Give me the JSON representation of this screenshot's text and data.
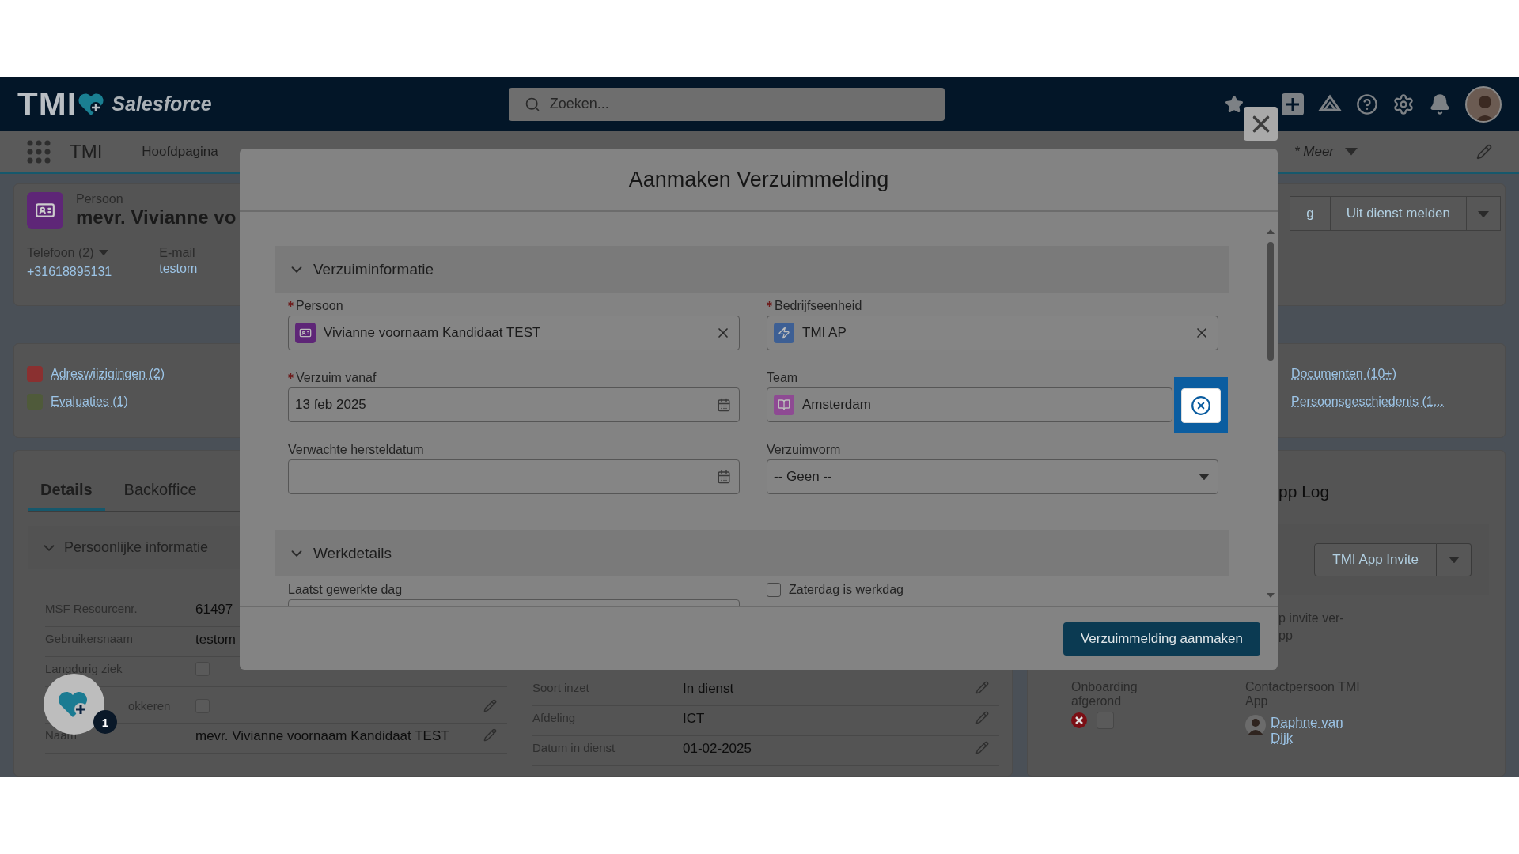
{
  "header": {
    "logo": "TMI",
    "brand": "Salesforce",
    "search": {
      "placeholder": "Zoeken..."
    }
  },
  "nav": {
    "app": "TMI",
    "items": [
      {
        "label": "Hoofdpagina"
      }
    ],
    "more": "* Meer"
  },
  "record": {
    "type": "Persoon",
    "name": "mevr. Vivianne vo",
    "phone_label": "Telefoon (2)",
    "phone": "+31618895131",
    "email_label": "E-mail",
    "email": "testom",
    "actions": [
      "g",
      "Uit dienst melden"
    ]
  },
  "related": {
    "left": [
      {
        "label": "Adreswijzigingen (2)",
        "color": "#8a3030"
      },
      {
        "label": "Evaluaties (1)",
        "color": "#4f5a3a"
      }
    ],
    "right": [
      {
        "label": "Documenten (10+)"
      },
      {
        "label": "Persoonsgeschiedenis (1..."
      }
    ]
  },
  "details": {
    "tabs": [
      {
        "label": "Details",
        "selected": true
      },
      {
        "label": "Backoffice",
        "selected": false
      }
    ],
    "section": "Persoonlijke informatie",
    "rows": [
      {
        "kind": "text",
        "label": "MSF Resourcenr.",
        "value": "61497",
        "covered": false
      },
      {
        "kind": "text",
        "label": "Gebruikersnaam",
        "value": "testom",
        "covered": false
      },
      {
        "kind": "checkbox",
        "label": "Langdurig ziek",
        "checked": false,
        "covered": false
      },
      {
        "kind": "checkbox",
        "label": "okkeren",
        "checked": false,
        "covered": true
      },
      {
        "kind": "text",
        "label": "Naam",
        "value": "mevr. Vivianne voornaam Kandidaat TEST",
        "covered": false
      }
    ],
    "rows_right": [
      {
        "label": "Soort inzet",
        "value": "In dienst"
      },
      {
        "label": "Afdeling",
        "value": "ICT"
      },
      {
        "label": "Datum in dienst",
        "value": "01-02-2025"
      }
    ]
  },
  "app_log": {
    "tab": "pp Log",
    "invite_button": "TMI App Invite",
    "note": [
      "p invite ver-",
      "pp"
    ],
    "onboarding": {
      "label": "Onboarding afgerond",
      "done": false,
      "checked": false
    },
    "contact": {
      "label": "Contactpersoon TMI App",
      "name": "Daphne van Dijk"
    }
  },
  "notification_count": "1",
  "modal": {
    "title": "Aanmaken Verzuimmelding",
    "submit": "Verzuimmelding aanmaken",
    "sections": [
      {
        "title": "Verzuiminformatie",
        "expanded": true,
        "fields": [
          {
            "kind": "lookup",
            "label": "Persoon",
            "required": true,
            "value": "Vivianne voornaam Kandidaat TEST",
            "color": "#5e2677",
            "highlighted": false
          },
          {
            "kind": "lookup",
            "label": "Bedrijfseenheid",
            "required": true,
            "value": "TMI AP",
            "color": "#3d5f94",
            "highlighted": false
          },
          {
            "kind": "date",
            "label": "Verzuim vanaf",
            "required": true,
            "value": "13 feb 2025"
          },
          {
            "kind": "lookup",
            "label": "Team",
            "required": false,
            "value": "Amsterdam",
            "color": "#8e4a93",
            "highlighted": true
          },
          {
            "kind": "date",
            "label": "Verwachte hersteldatum",
            "required": false
          },
          {
            "kind": "select",
            "label": "Verzuimvorm",
            "required": false,
            "value": "-- Geen --"
          }
        ]
      },
      {
        "title": "Werkdetails",
        "expanded": true,
        "fields": [
          {
            "kind": "date",
            "label": "Laatst gewerkte dag",
            "required": false
          },
          {
            "kind": "checkbox",
            "label": "Zaterdag is werkdag",
            "checked": false
          }
        ]
      }
    ]
  }
}
